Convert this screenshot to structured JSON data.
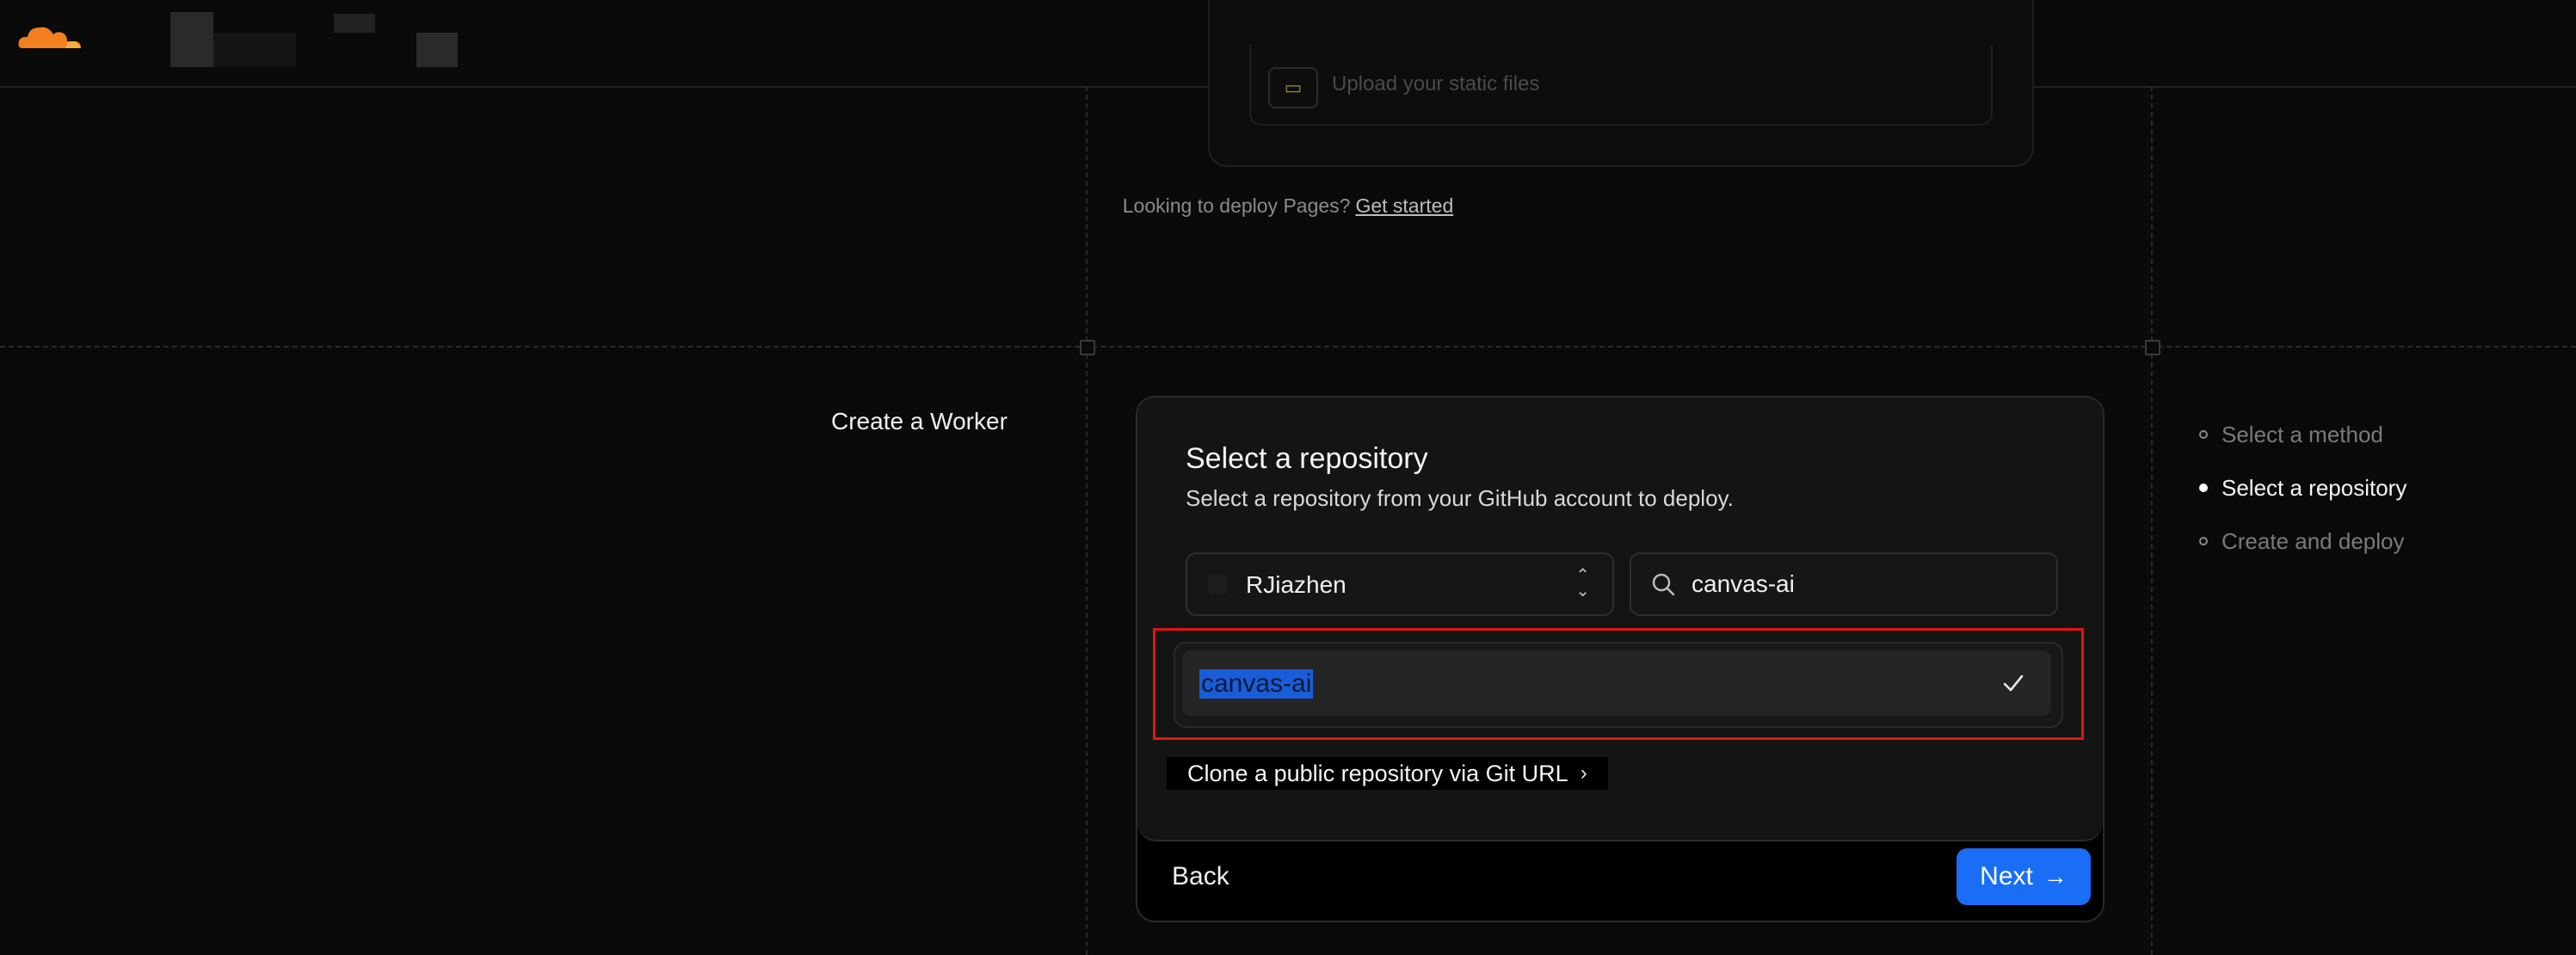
{
  "nav": {
    "logo_icon": "cloudflare-cloud-icon"
  },
  "upper": {
    "upload_label": "Upload your static files",
    "pages_note": "Looking to deploy Pages?",
    "pages_link": "Get started"
  },
  "page": {
    "title": "Create a Worker"
  },
  "card": {
    "title": "Select a repository",
    "subtitle": "Select a repository from your GitHub account to deploy.",
    "owner_select": {
      "value": "RJiazhen"
    },
    "search": {
      "value": "canvas-ai"
    },
    "repos": [
      {
        "name": "canvas-ai",
        "selected": true
      }
    ],
    "clone_link": "Clone a public repository via Git URL",
    "back_label": "Back",
    "next_label": "Next"
  },
  "steps": [
    {
      "label": "Select a method",
      "state": "done"
    },
    {
      "label": "Select a repository",
      "state": "active"
    },
    {
      "label": "Create and deploy",
      "state": "todo"
    }
  ],
  "colors": {
    "accent": "#1a6ef5",
    "highlight_border": "#e01515",
    "brand": "#f38020"
  }
}
